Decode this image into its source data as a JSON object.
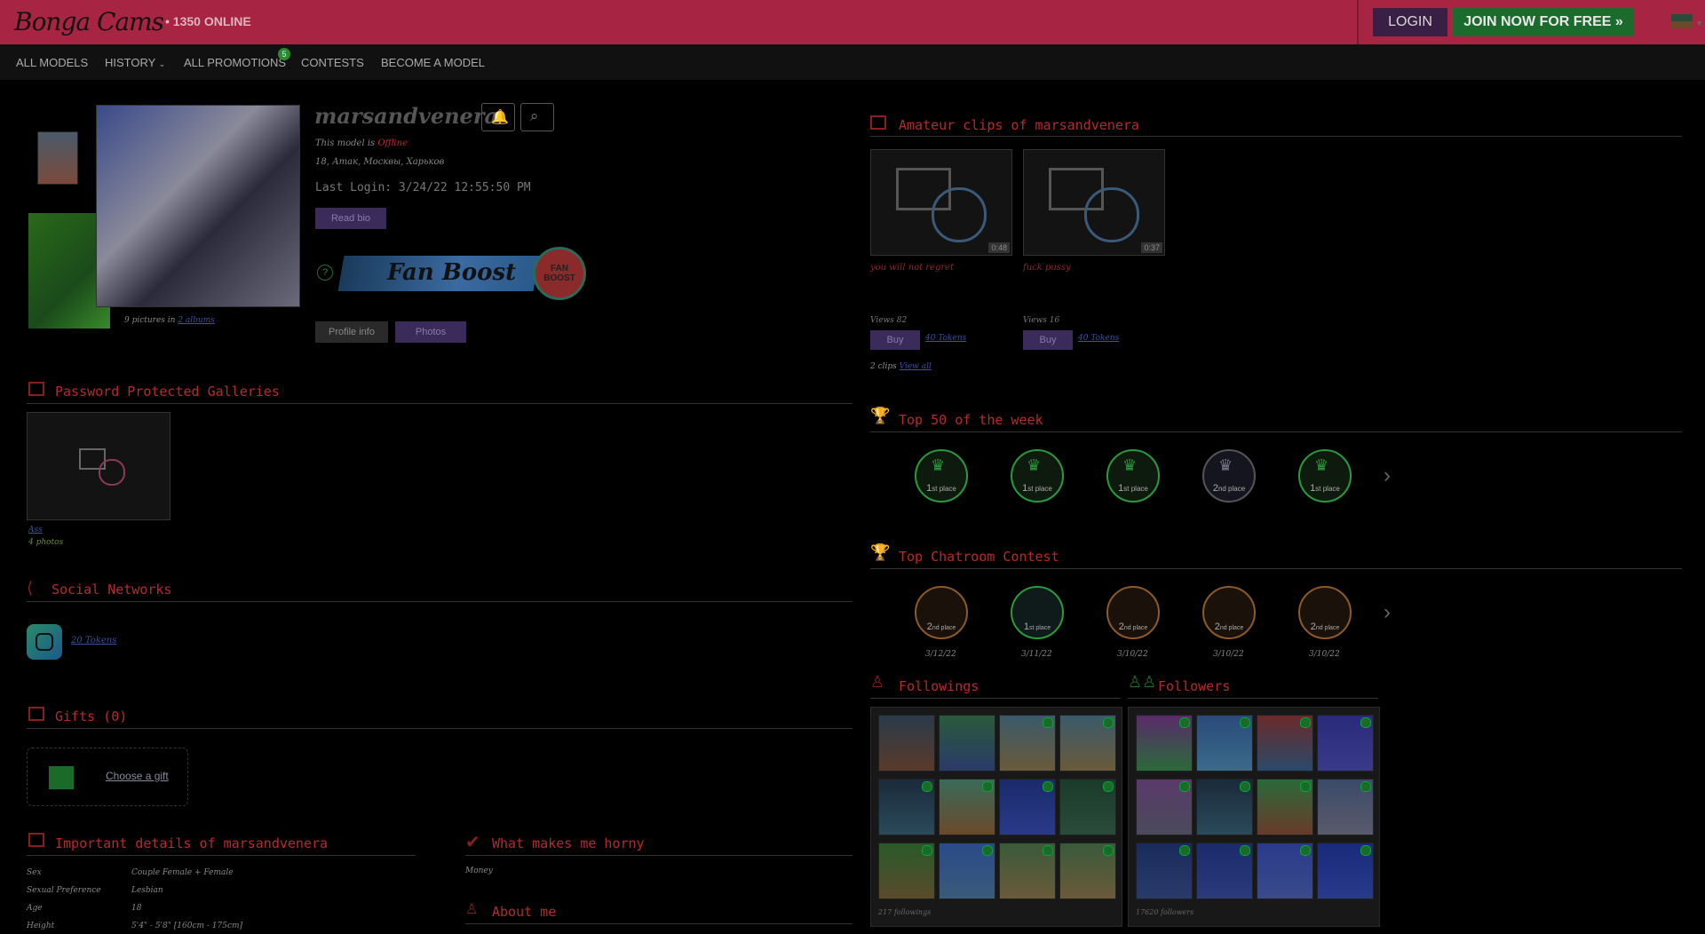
{
  "header": {
    "logo": "Bonga Cams",
    "online": "• 1350 ONLINE",
    "login": "LOGIN",
    "join": "JOIN NOW FOR FREE »"
  },
  "nav": {
    "all_models": "ALL MODELS",
    "history": "HISTORY",
    "promotions": "ALL PROMOTIONS",
    "promotions_badge": "5",
    "contests": "CONTESTS",
    "become": "BECOME A MODEL"
  },
  "profile": {
    "name": "marsandvenera",
    "status_prefix": "This model is",
    "status": "Offline",
    "location": "18, Атак, Москвы, Харьков",
    "last_login": "Last Login: 3/24/22 12:55:50 PM",
    "read_bio": "Read bio",
    "fan_boost": "Fan Boost",
    "fan_boost_badge": "FAN BOOST",
    "help": "?",
    "pictures": "9 pictures in",
    "albums": "2 albums",
    "profile_info": "Profile info",
    "photos": "Photos"
  },
  "password_galleries": {
    "title": "Password Protected Galleries",
    "item_name": "Ass",
    "item_count": "4 photos"
  },
  "social": {
    "title": "Social Networks",
    "price": "20 Tokens"
  },
  "gifts": {
    "title": "Gifts (0)",
    "choose": "Choose a gift"
  },
  "details": {
    "title": "Important details of marsandvenera",
    "rows": [
      {
        "label": "Sex",
        "value": "Couple Female + Female"
      },
      {
        "label": "Sexual Preference",
        "value": "Lesbian"
      },
      {
        "label": "Age",
        "value": "18"
      },
      {
        "label": "Height",
        "value": "5'4\" - 5'8\" [160cm - 175cm]"
      }
    ]
  },
  "horny": {
    "title": "What makes me horny",
    "value": "Money"
  },
  "about": {
    "title": "About me"
  },
  "clips": {
    "title": "Amateur clips of marsandvenera",
    "items": [
      {
        "title": "you will not regret",
        "duration": "0:48",
        "views": "Views 82",
        "buy": "Buy",
        "price": "40 Tokens"
      },
      {
        "title": "fuck pussy",
        "duration": "0:37",
        "views": "Views 16",
        "buy": "Buy",
        "price": "40 Tokens"
      }
    ],
    "count": "2 clips",
    "view_all": "View all"
  },
  "top50": {
    "title": "Top 50 of the week",
    "badges": [
      {
        "place": "1",
        "suffix": "st place"
      },
      {
        "place": "1",
        "suffix": "st place"
      },
      {
        "place": "1",
        "suffix": "st place"
      },
      {
        "place": "2",
        "suffix": "nd place"
      },
      {
        "place": "1",
        "suffix": "st place"
      }
    ]
  },
  "chatroom": {
    "title": "Top Chatroom Contest",
    "badges": [
      {
        "place": "2",
        "suffix": "nd place",
        "date": "3/12/22"
      },
      {
        "place": "1",
        "suffix": "st place",
        "date": "3/11/22"
      },
      {
        "place": "2",
        "suffix": "nd place",
        "date": "3/10/22"
      },
      {
        "place": "2",
        "suffix": "nd place",
        "date": "3/10/22"
      },
      {
        "place": "2",
        "suffix": "nd place",
        "date": "3/10/22"
      }
    ]
  },
  "followings": {
    "title": "Followings",
    "count": "217 followings"
  },
  "followers": {
    "title": "Followers",
    "count": "17620 followers"
  },
  "colors": {
    "brand": "#a82443",
    "accent_red": "#b82a2a",
    "green": "#1a6b2c",
    "purple": "#3b2b5a"
  }
}
